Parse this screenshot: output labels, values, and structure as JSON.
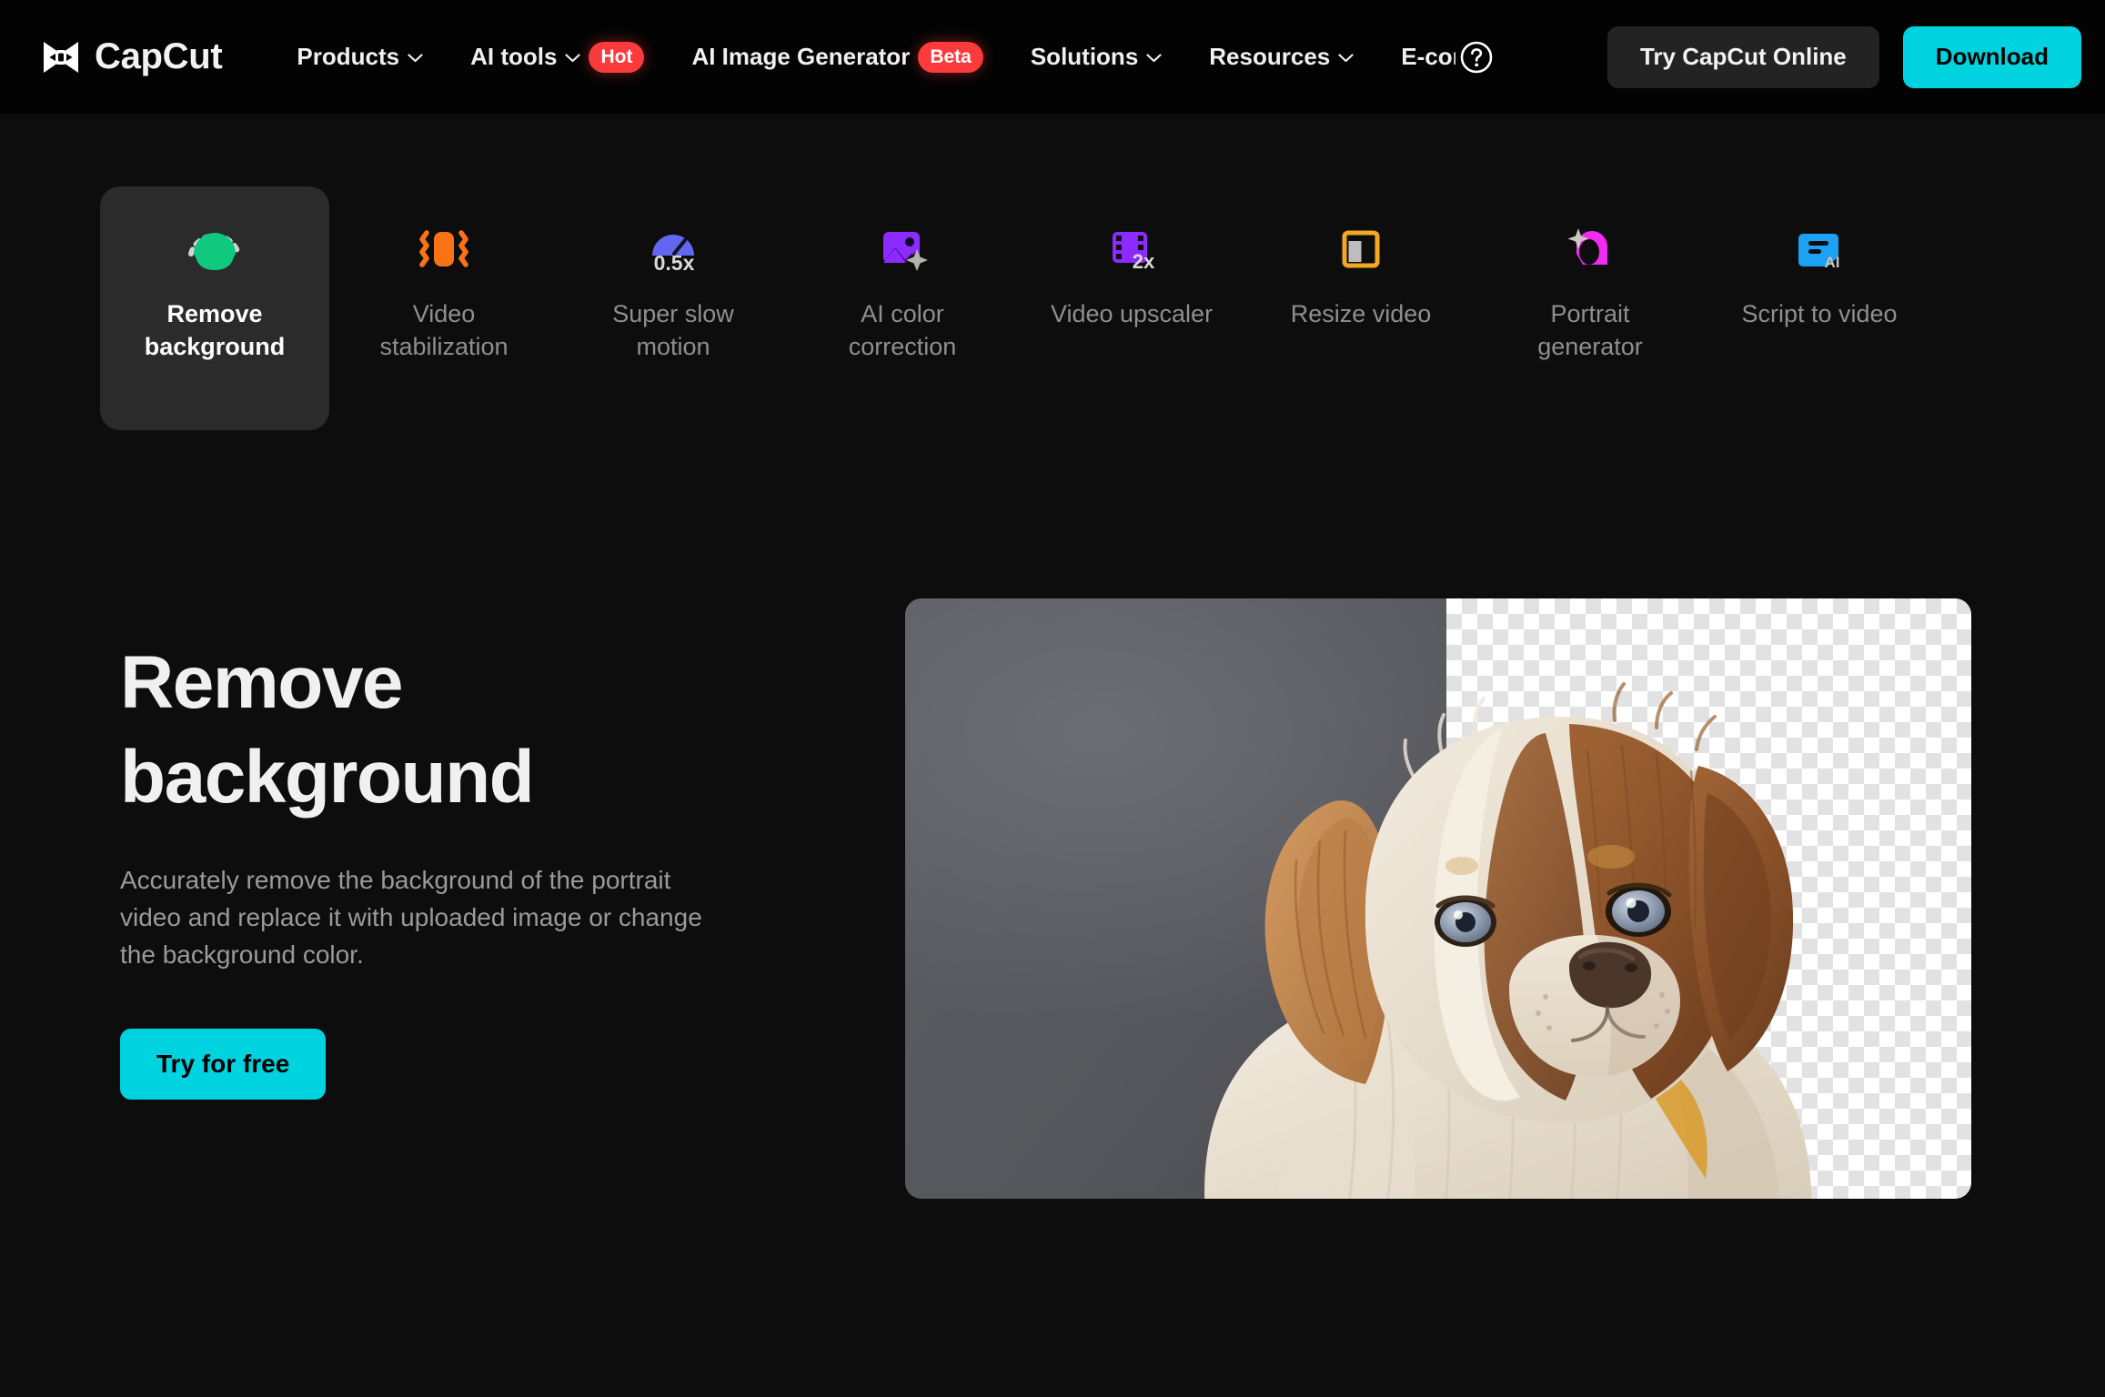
{
  "brand": {
    "name": "CapCut",
    "logo_icon": "capcut-logo-icon"
  },
  "nav": {
    "items": [
      {
        "label": "Products",
        "has_chevron": true,
        "badge": null
      },
      {
        "label": "AI tools",
        "has_chevron": true,
        "badge": "Hot"
      },
      {
        "label": "AI Image Generator",
        "has_chevron": false,
        "badge": "Beta"
      },
      {
        "label": "Solutions",
        "has_chevron": true,
        "badge": null
      },
      {
        "label": "Resources",
        "has_chevron": true,
        "badge": null
      },
      {
        "label": "E-commerce",
        "has_chevron": false,
        "badge": null
      }
    ],
    "help_icon": "question-mark-circle-icon",
    "actions": {
      "secondary_label": "Try CapCut Online",
      "primary_label": "Download"
    },
    "colors": {
      "badge": "#FB3B3B",
      "primary_button": "#00D3E0",
      "secondary_button": "#232323",
      "bar_background": "#030303"
    }
  },
  "tools": [
    {
      "label": "Remove\nbackground",
      "label_line1": "Remove",
      "label_line2": "background",
      "icon": "person-in-dashed-circle-icon",
      "color": "#0EC97E",
      "active": true
    },
    {
      "label": "Video stabilization",
      "label_line1": "Video",
      "label_line2": "stabilization",
      "icon": "stabilize-shake-icon",
      "color": "#F97316",
      "active": false
    },
    {
      "label": "Super slow motion",
      "label_line1": "Super slow",
      "label_line2": "motion",
      "icon": "speedometer-0.5x-icon",
      "color": "#6366F1",
      "badge_text": "0.5x",
      "active": false
    },
    {
      "label": "AI color correction",
      "label_line1": "AI color",
      "label_line2": "correction",
      "icon": "image-sparkle-icon",
      "color": "#8B2BFF",
      "active": false
    },
    {
      "label": "Video upscaler",
      "label_line1": "Video upscaler",
      "label_line2": "",
      "icon": "film-strip-2x-icon",
      "color": "#8B2BFF",
      "badge_text": "2x",
      "active": false
    },
    {
      "label": "Resize video",
      "label_line1": "Resize video",
      "label_line2": "",
      "icon": "resize-frame-icon",
      "color": "#F5A623",
      "active": false
    },
    {
      "label": "Portrait generator",
      "label_line1": "Portrait",
      "label_line2": "generator",
      "icon": "portrait-sparkle-icon",
      "color": "#F22BF2",
      "active": false
    },
    {
      "label": "Script to video",
      "label_line1": "Script to video",
      "label_line2": "",
      "icon": "script-ai-card-icon",
      "color": "#1DA1F2",
      "active": false
    }
  ],
  "hero": {
    "title_line1": "Remove",
    "title_line2": "background",
    "description": "Accurately remove the background of the portrait video and replace it with uploaded image or change the background color.",
    "cta_label": "Try for free",
    "cta_color": "#00D3E0",
    "media": {
      "alt_name": "dog-portrait-background-removal-preview",
      "left_state": "original-gray-studio-background",
      "right_state": "transparent-checkerboard"
    }
  }
}
